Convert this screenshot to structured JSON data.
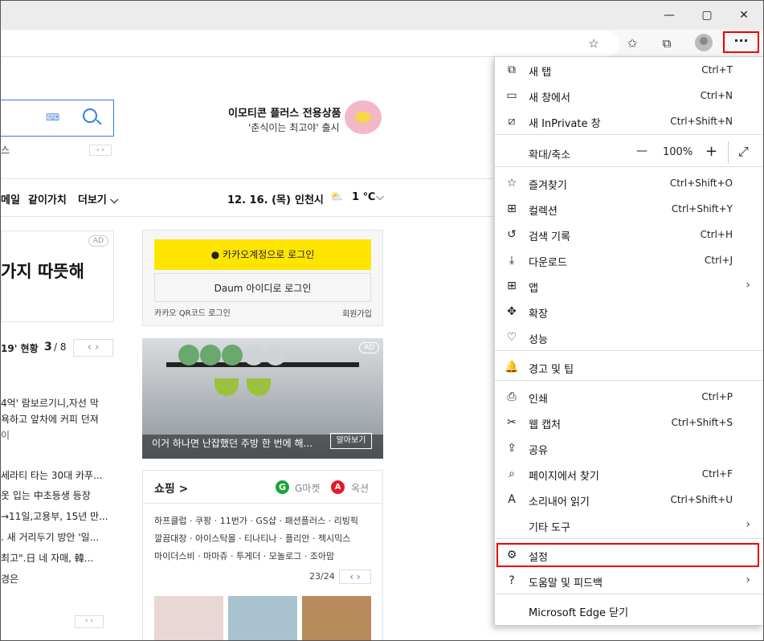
{
  "window": {
    "minimize": "—",
    "maximize": "▢",
    "close": "✕"
  },
  "toolbar": {
    "more_label": "···"
  },
  "page": {
    "search_small_text": "스",
    "emoticon_title": "이모티콘 플러스 전용상품",
    "emoticon_sub": "'춘식이는 최고야' 출시",
    "nav": [
      "메일",
      "같이가치",
      "더보기"
    ],
    "date": "12. 16. (목)",
    "city": "인천시",
    "temp": "1 ℃",
    "ad_badge": "AD",
    "big_headline": "가지 따뜻해",
    "rank_title": "19' 현황",
    "rank_page": "3",
    "rank_total": "/ 8",
    "news": [
      "4억' 람보르기니,자선 막",
      "욕하고 앞차에 커피 던져",
      "이",
      "세라티 타는 30대 카푸...",
      "옷 입는 中초등생 등장",
      "→11일,고용부, 15년 만...",
      ". 새 거리두기 방안 '일...",
      "최고\".日 네 자매, 韓...",
      "경은"
    ],
    "kakao_login": "카카오계정으로 로그인",
    "daum_login": "Daum 아이디로 로그인",
    "qr_login": "카카오 QR코드 로그인",
    "signup": "회원가입",
    "dish_caption": "이거 하나면 난잡했던 주방 한 번에 해...",
    "dish_button": "알아보기",
    "shopping_title": "쇼핑 >",
    "gmarket": "G마켓",
    "auction": "옥션",
    "shop_lines": [
      "하프클럽 · 쿠팡 · 11번가 · GS샵 · 패션플러스 · 리빙픽",
      "깔끔대장 · 아이스탁몰 · 티나티나 · 플리안 · 젝시믹스",
      "마이더스비 · 마마쥬 · 투게더 · 모놀로그 · 조아맘"
    ],
    "shop_page": "23/24"
  },
  "menu": {
    "items": [
      {
        "icon": "new-tab-icon",
        "glyph": "⧉",
        "label": "새 탭",
        "shortcut": "Ctrl+T"
      },
      {
        "icon": "new-window-icon",
        "glyph": "▭",
        "label": "새 창에서",
        "shortcut": "Ctrl+N"
      },
      {
        "icon": "inprivate-icon",
        "glyph": "⧄",
        "label": "새 InPrivate 창",
        "shortcut": "Ctrl+Shift+N"
      },
      {
        "icon": "favorites-icon",
        "glyph": "☆",
        "label": "즐겨찾기",
        "shortcut": "Ctrl+Shift+O"
      },
      {
        "icon": "collections-icon",
        "glyph": "⊞",
        "label": "컬렉션",
        "shortcut": "Ctrl+Shift+Y"
      },
      {
        "icon": "history-icon",
        "glyph": "↺",
        "label": "검색 기록",
        "shortcut": "Ctrl+H"
      },
      {
        "icon": "download-icon",
        "glyph": "⤓",
        "label": "다운로드",
        "shortcut": "Ctrl+J"
      },
      {
        "icon": "apps-icon",
        "glyph": "⊞",
        "label": "앱",
        "shortcut": ""
      },
      {
        "icon": "extensions-icon",
        "glyph": "✥",
        "label": "확장",
        "shortcut": ""
      },
      {
        "icon": "performance-icon",
        "glyph": "♡",
        "label": "성능",
        "shortcut": ""
      },
      {
        "icon": "alerts-icon",
        "glyph": "🔔",
        "label": "경고 및 팁",
        "shortcut": ""
      },
      {
        "icon": "print-icon",
        "glyph": "⎙",
        "label": "인쇄",
        "shortcut": "Ctrl+P"
      },
      {
        "icon": "web-capture-icon",
        "glyph": "✂",
        "label": "웹 캡처",
        "shortcut": "Ctrl+Shift+S"
      },
      {
        "icon": "share-icon",
        "glyph": "⇪",
        "label": "공유",
        "shortcut": ""
      },
      {
        "icon": "find-icon",
        "glyph": "⌕",
        "label": "페이지에서 찾기",
        "shortcut": "Ctrl+F"
      },
      {
        "icon": "read-aloud-icon",
        "glyph": "A",
        "label": "소리내어 읽기",
        "shortcut": "Ctrl+Shift+U"
      },
      {
        "icon": "",
        "glyph": "",
        "label": "기타 도구",
        "shortcut": ""
      },
      {
        "icon": "settings-icon",
        "glyph": "⚙",
        "label": "설정",
        "shortcut": ""
      },
      {
        "icon": "help-icon",
        "glyph": "?",
        "label": "도움말 및 피드백",
        "shortcut": ""
      },
      {
        "icon": "",
        "glyph": "",
        "label": "Microsoft Edge 닫기",
        "shortcut": ""
      }
    ],
    "zoom": {
      "label": "확대/축소",
      "minus": "—",
      "value": "100%",
      "plus": "+",
      "fullscreen": "⤢"
    }
  },
  "colors": {
    "highlight": "#e00000",
    "kakao": "#fee500",
    "link_blue": "#2f7ee0"
  }
}
